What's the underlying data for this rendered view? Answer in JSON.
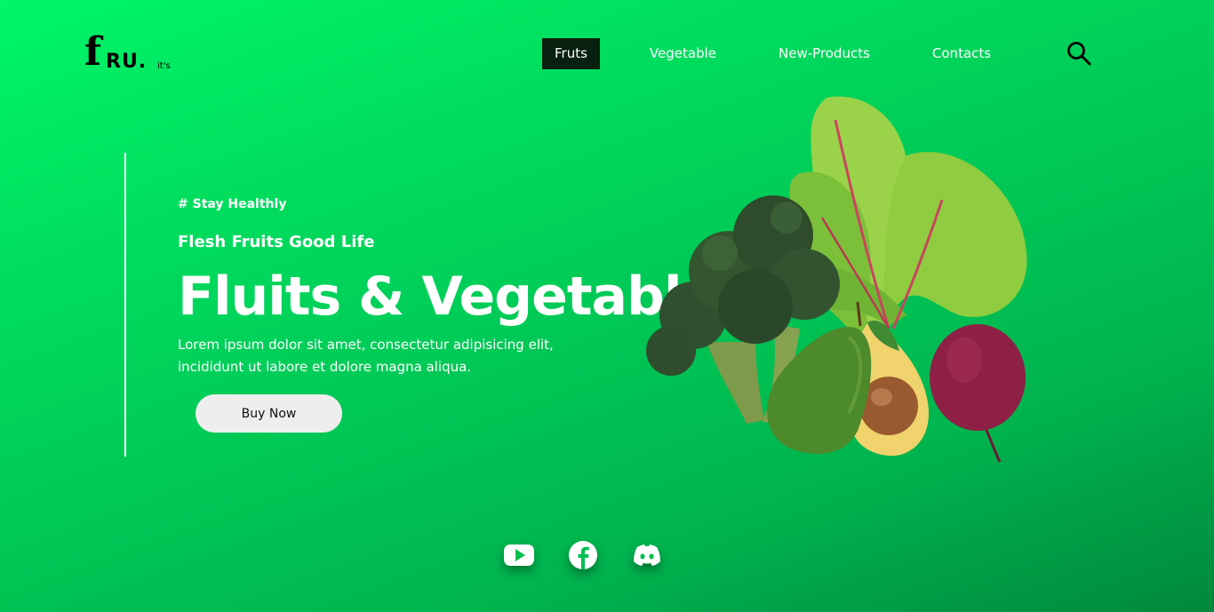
{
  "logo": {
    "letter": "f",
    "rest": "RU.",
    "suffix": "it's"
  },
  "nav": {
    "items": [
      {
        "label": "Fruts",
        "active": true
      },
      {
        "label": "Vegetable",
        "active": false
      },
      {
        "label": "New-Products",
        "active": false
      },
      {
        "label": "Contacts",
        "active": false
      }
    ],
    "search_icon": "search-icon"
  },
  "hero": {
    "tag": "# Stay Healthly",
    "subtitle": "Flesh Fruits Good Life",
    "headline": "Fluits & Vegetable",
    "description": "Lorem ipsum dolor sit amet, consectetur adipisicing elit, incididunt ut labore et dolore magna aliqua.",
    "button_label": "Buy Now"
  },
  "social": [
    "youtube-icon",
    "facebook-icon",
    "discord-icon"
  ],
  "colors": {
    "background_start": "#00f567",
    "background_end": "#00883c",
    "nav_active_bg": "#07200f",
    "button_bg": "#eeeeee"
  }
}
